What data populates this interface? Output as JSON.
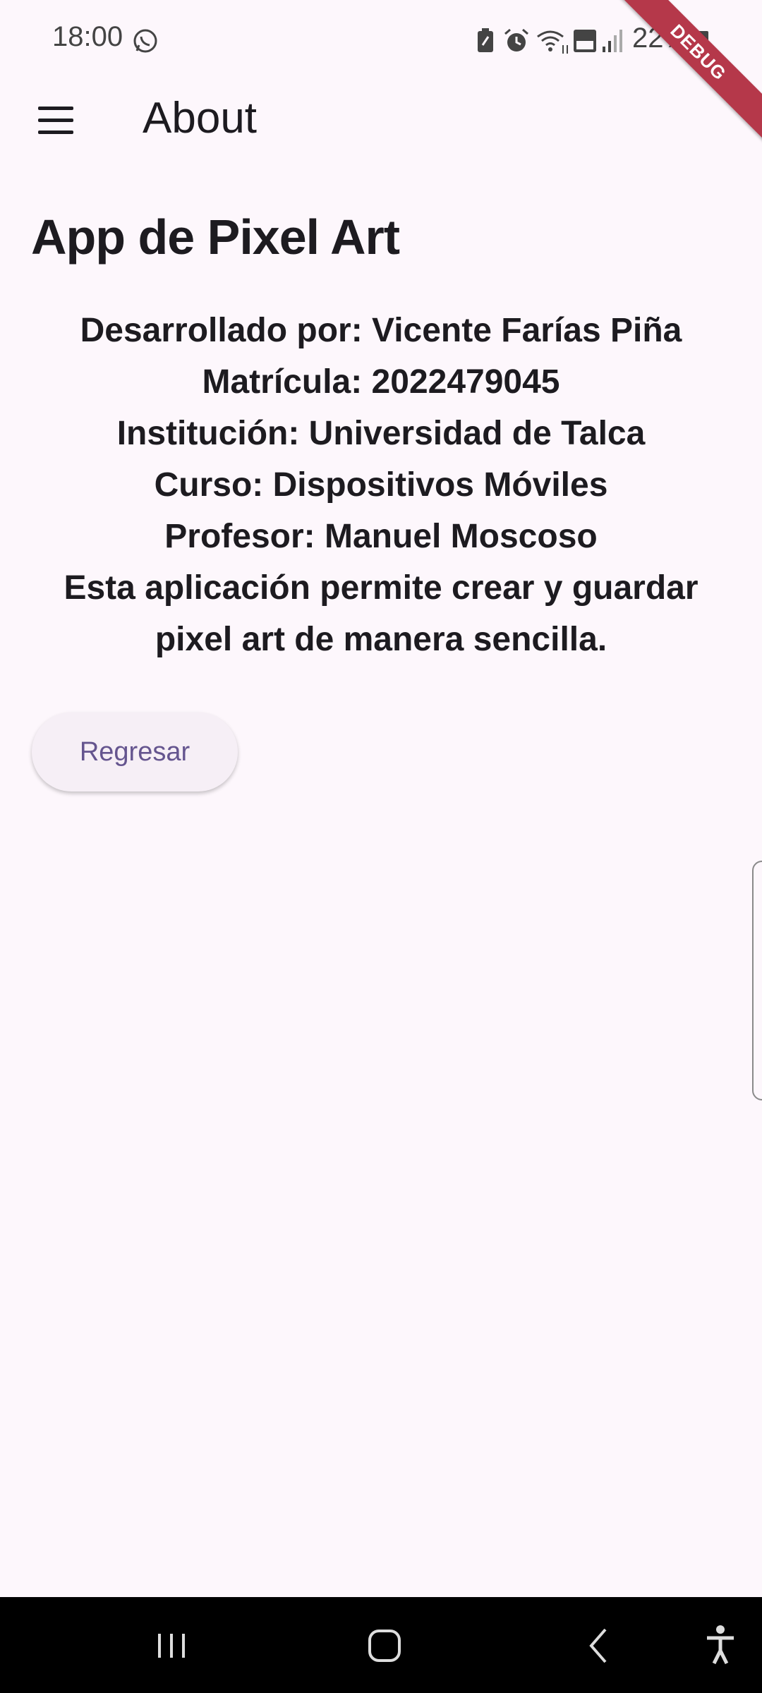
{
  "status_bar": {
    "time": "18:00",
    "battery": "22%",
    "icons": [
      "whatsapp-icon",
      "battery-saver-icon",
      "alarm-icon",
      "wifi-icon",
      "volte-icon",
      "signal-icon",
      "battery-icon"
    ]
  },
  "debug_banner": "DEBUG",
  "app_bar": {
    "title": "About",
    "menu_icon": "menu-icon"
  },
  "content": {
    "heading": "App de Pixel Art",
    "lines": [
      "Desarrollado por: Vicente Farías Piña",
      "Matrícula: 2022479045",
      "Institución: Universidad de Talca",
      "Curso: Dispositivos Móviles",
      "Profesor: Manuel Moscoso",
      "Esta aplicación permite crear y guardar",
      "pixel art de manera sencilla."
    ],
    "back_button": "Regresar"
  },
  "nav_bar": {
    "icons": [
      "recents-icon",
      "home-icon",
      "back-icon",
      "accessibility-icon"
    ]
  }
}
